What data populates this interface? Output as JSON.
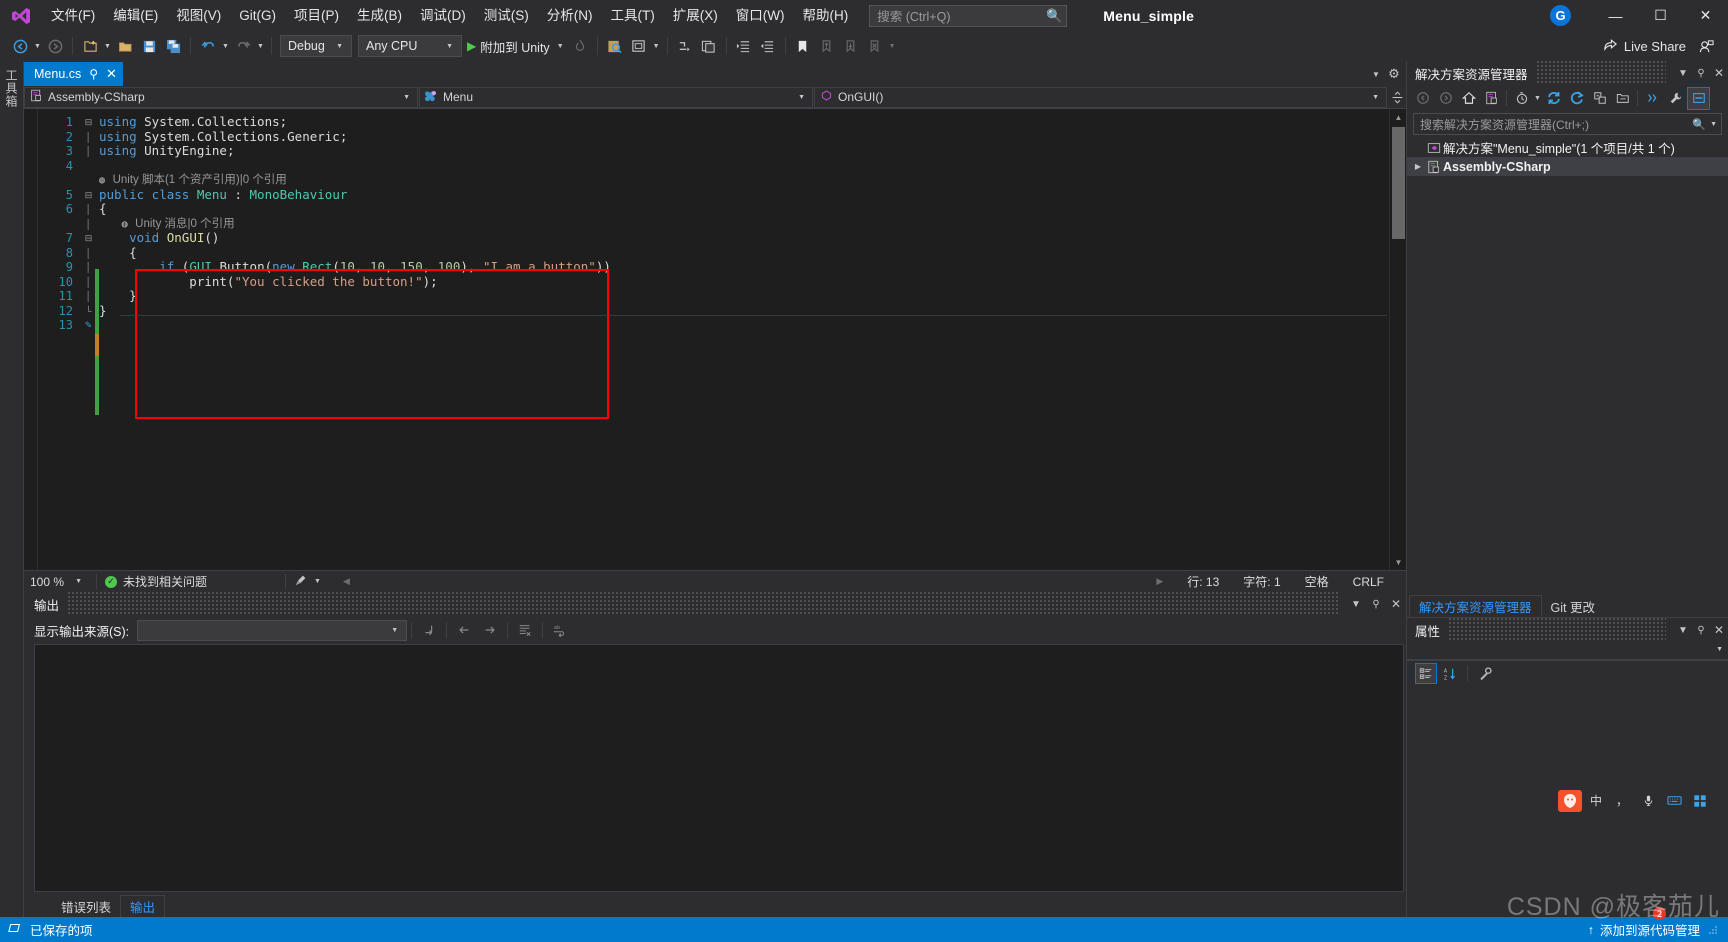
{
  "window": {
    "title": "Menu_simple",
    "account_initial": "G",
    "minimize": "—",
    "maximize": "☐",
    "close": "✕"
  },
  "menubar": [
    {
      "label": "文件(F)",
      "name": "menu-file"
    },
    {
      "label": "编辑(E)",
      "name": "menu-edit"
    },
    {
      "label": "视图(V)",
      "name": "menu-view"
    },
    {
      "label": "Git(G)",
      "name": "menu-git"
    },
    {
      "label": "项目(P)",
      "name": "menu-project"
    },
    {
      "label": "生成(B)",
      "name": "menu-build"
    },
    {
      "label": "调试(D)",
      "name": "menu-debug"
    },
    {
      "label": "测试(S)",
      "name": "menu-test"
    },
    {
      "label": "分析(N)",
      "name": "menu-analyze"
    },
    {
      "label": "工具(T)",
      "name": "menu-tools"
    },
    {
      "label": "扩展(X)",
      "name": "menu-extensions"
    },
    {
      "label": "窗口(W)",
      "name": "menu-window"
    },
    {
      "label": "帮助(H)",
      "name": "menu-help"
    }
  ],
  "search": {
    "placeholder": "搜索 (Ctrl+Q)",
    "icon": "magnifier-icon"
  },
  "toolbar": {
    "config": "Debug",
    "platform": "Any CPU",
    "run_label": "附加到 Unity",
    "live_share": "Live Share"
  },
  "editor": {
    "tab_name": "Menu.cs",
    "nav_project": "Assembly-CSharp",
    "nav_type": "Menu",
    "nav_member": "OnGUI()",
    "zoom": "100 %",
    "issues": "未找到相关问题",
    "line": "行: 13",
    "col": "字符: 1",
    "sel": "空格",
    "eol": "CRLF",
    "codelens_class": "Unity 脚本(1 个资产引用)|0 个引用",
    "codelens_method": "Unity 消息|0 个引用",
    "lines": [
      {
        "n": "1",
        "fold": "⊟",
        "segments": [
          {
            "t": "using ",
            "c": "kw"
          },
          {
            "t": "System.Collections;",
            "c": "pl"
          }
        ]
      },
      {
        "n": "2",
        "fold": "",
        "segments": [
          {
            "t": "using ",
            "c": "kw"
          },
          {
            "t": "System.Collections.Generic;",
            "c": "pl"
          }
        ]
      },
      {
        "n": "3",
        "fold": "",
        "segments": [
          {
            "t": "using ",
            "c": "kw"
          },
          {
            "t": "UnityEngine;",
            "c": "pl"
          }
        ]
      },
      {
        "n": "4",
        "fold": "",
        "segments": []
      },
      {
        "n": "5",
        "fold": "⊟",
        "segments": [
          {
            "t": "public class ",
            "c": "kw"
          },
          {
            "t": "Menu",
            "c": "type"
          },
          {
            "t": " : ",
            "c": "pl"
          },
          {
            "t": "MonoBehaviour",
            "c": "type"
          }
        ]
      },
      {
        "n": "6",
        "fold": "",
        "segments": [
          {
            "t": "{",
            "c": "pl"
          }
        ]
      },
      {
        "n": "7",
        "fold": "⊟",
        "segments": [
          {
            "t": "    void ",
            "c": "kw"
          },
          {
            "t": "OnGUI",
            "c": "mth"
          },
          {
            "t": "()",
            "c": "pl"
          }
        ]
      },
      {
        "n": "8",
        "fold": "",
        "segments": [
          {
            "t": "    {",
            "c": "pl"
          }
        ]
      },
      {
        "n": "9",
        "fold": "",
        "segments": [
          {
            "t": "        ",
            "c": "pl"
          },
          {
            "t": "if",
            "c": "kw"
          },
          {
            "t": " (",
            "c": "pl"
          },
          {
            "t": "GUI",
            "c": "type"
          },
          {
            "t": ".Button(",
            "c": "pl"
          },
          {
            "t": "new ",
            "c": "kw"
          },
          {
            "t": "Rect",
            "c": "type"
          },
          {
            "t": "(",
            "c": "pl"
          },
          {
            "t": "10",
            "c": "num"
          },
          {
            "t": ", ",
            "c": "pl"
          },
          {
            "t": "10",
            "c": "num"
          },
          {
            "t": ", ",
            "c": "pl"
          },
          {
            "t": "150",
            "c": "num"
          },
          {
            "t": ", ",
            "c": "pl"
          },
          {
            "t": "100",
            "c": "num"
          },
          {
            "t": "), ",
            "c": "pl"
          },
          {
            "t": "\"I am a button\"",
            "c": "str"
          },
          {
            "t": "))",
            "c": "pl"
          }
        ]
      },
      {
        "n": "10",
        "fold": "",
        "segments": [
          {
            "t": "            print(",
            "c": "pl"
          },
          {
            "t": "\"You clicked the button!\"",
            "c": "str"
          },
          {
            "t": ");",
            "c": "pl"
          }
        ]
      },
      {
        "n": "11",
        "fold": "",
        "segments": [
          {
            "t": "    }",
            "c": "pl"
          }
        ]
      },
      {
        "n": "12",
        "fold": "",
        "segments": [
          {
            "t": "}",
            "c": "pl"
          }
        ]
      },
      {
        "n": "13",
        "fold": "",
        "segments": []
      }
    ]
  },
  "output_pane": {
    "title": "输出",
    "source_label": "显示输出来源(S):",
    "source_value": "",
    "buttons": [
      "jump-to-location-icon",
      "previous-message-icon",
      "next-message-icon",
      "clear-all-icon",
      "toggle-word-wrap-icon"
    ]
  },
  "bottom_tabs": [
    {
      "label": "错误列表",
      "active": false,
      "name": "tab-error-list"
    },
    {
      "label": "输出",
      "active": true,
      "name": "tab-output"
    }
  ],
  "solution_explorer": {
    "title": "解决方案资源管理器",
    "search_placeholder": "搜索解决方案资源管理器(Ctrl+;)",
    "tree": [
      {
        "label": "解决方案\"Menu_simple\"(1 个项目/共 1 个)",
        "icon": "solution-icon",
        "expander": "",
        "bold": false,
        "selected": false
      },
      {
        "label": "Assembly-CSharp",
        "icon": "csproj-icon",
        "expander": "▶",
        "bold": true,
        "selected": true
      }
    ],
    "toolbar": [
      "back-icon",
      "forward-icon",
      "home-icon",
      "pending-changes-filter-icon",
      "history-icon",
      "sync-icon",
      "refresh-icon",
      "collapse-all-icon",
      "show-all-files-icon",
      "properties-icon",
      "preview-selected-icon"
    ]
  },
  "dock_tabs": [
    {
      "label": "解决方案资源管理器",
      "active": true,
      "name": "dock-tab-solution-explorer"
    },
    {
      "label": "Git 更改",
      "active": false,
      "name": "dock-tab-git-changes"
    }
  ],
  "properties_pane": {
    "title": "属性",
    "buttons": [
      "categorized-icon",
      "alphabetical-icon",
      "property-pages-icon"
    ]
  },
  "ime": {
    "logo": "S",
    "mode": "中",
    "punct": "，",
    "voice": "🎤",
    "keyboard": "⌨",
    "apps": "▦"
  },
  "statusbar": {
    "saved_text": "已保存的项",
    "source_control": "添加到源代码管理",
    "up_arrow": "↑",
    "notification_count": "2"
  },
  "watermark": "CSDN @极客茄儿",
  "colors": {
    "accent": "#007acc",
    "annotation": "#ff0000",
    "chrome": "#2d2d30",
    "editor_bg": "#1e1e1e"
  }
}
